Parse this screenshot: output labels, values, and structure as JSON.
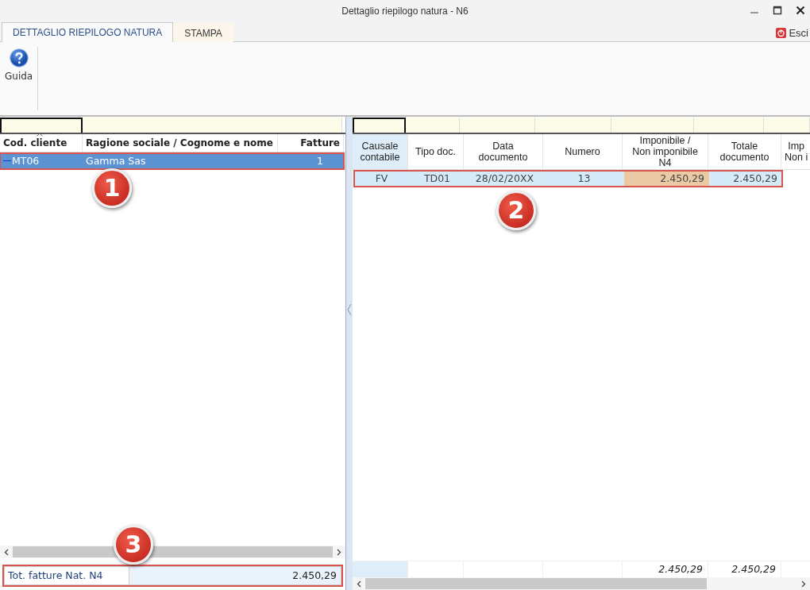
{
  "window": {
    "title": "Dettaglio riepilogo natura - N6"
  },
  "tabs": [
    {
      "label": "DETTAGLIO RIEPILOGO NATURA",
      "selected": true,
      "contextual": false
    },
    {
      "label": "STAMPA",
      "selected": false,
      "contextual": true
    }
  ],
  "exit_button": {
    "label": "Esci"
  },
  "ribbon": {
    "buttons": [
      {
        "label": "Guida"
      }
    ]
  },
  "clients": {
    "columns": [
      {
        "label": "Cod. cliente",
        "sorted": true
      },
      {
        "label": "Ragione sociale / Cognome e nome",
        "sorted": false
      },
      {
        "label": "Fatture",
        "sorted": false
      }
    ],
    "rows": [
      {
        "cells": [
          "MT06",
          "Gamma Sas",
          "1"
        ],
        "selected": true,
        "outlined": true
      }
    ],
    "total": {
      "label": "Tot. fatture Nat. N4",
      "value": "2.450,29",
      "outlined": true
    }
  },
  "documents": {
    "columns": [
      {
        "label": "Causale\ncontabile",
        "focused": true
      },
      {
        "label": "Tipo doc.",
        "focused": false
      },
      {
        "label": "Data\ndocumento",
        "focused": false
      },
      {
        "label": "Numero",
        "focused": false
      },
      {
        "label": "Imponibile /\nNon imponibile\nN4",
        "focused": false,
        "total": "2.450,29"
      },
      {
        "label": "Totale\ndocumento",
        "focused": false,
        "total": "2.450,29"
      },
      {
        "label": "Imp\nNon i",
        "focused": false
      }
    ],
    "rows": [
      {
        "cells": [
          {
            "text": "FV",
            "highlighted": false
          },
          {
            "text": "TD01",
            "highlighted": false
          },
          {
            "text": "28/02/20XX",
            "highlighted": false
          },
          {
            "text": "13",
            "highlighted": false
          },
          {
            "text": "2.450,29",
            "highlighted": true
          },
          {
            "text": "2.450,29",
            "highlighted": false
          }
        ],
        "selected": true,
        "outlined": true
      }
    ]
  },
  "callouts": [
    {
      "label": "1"
    },
    {
      "label": "2"
    },
    {
      "label": "3"
    }
  ]
}
